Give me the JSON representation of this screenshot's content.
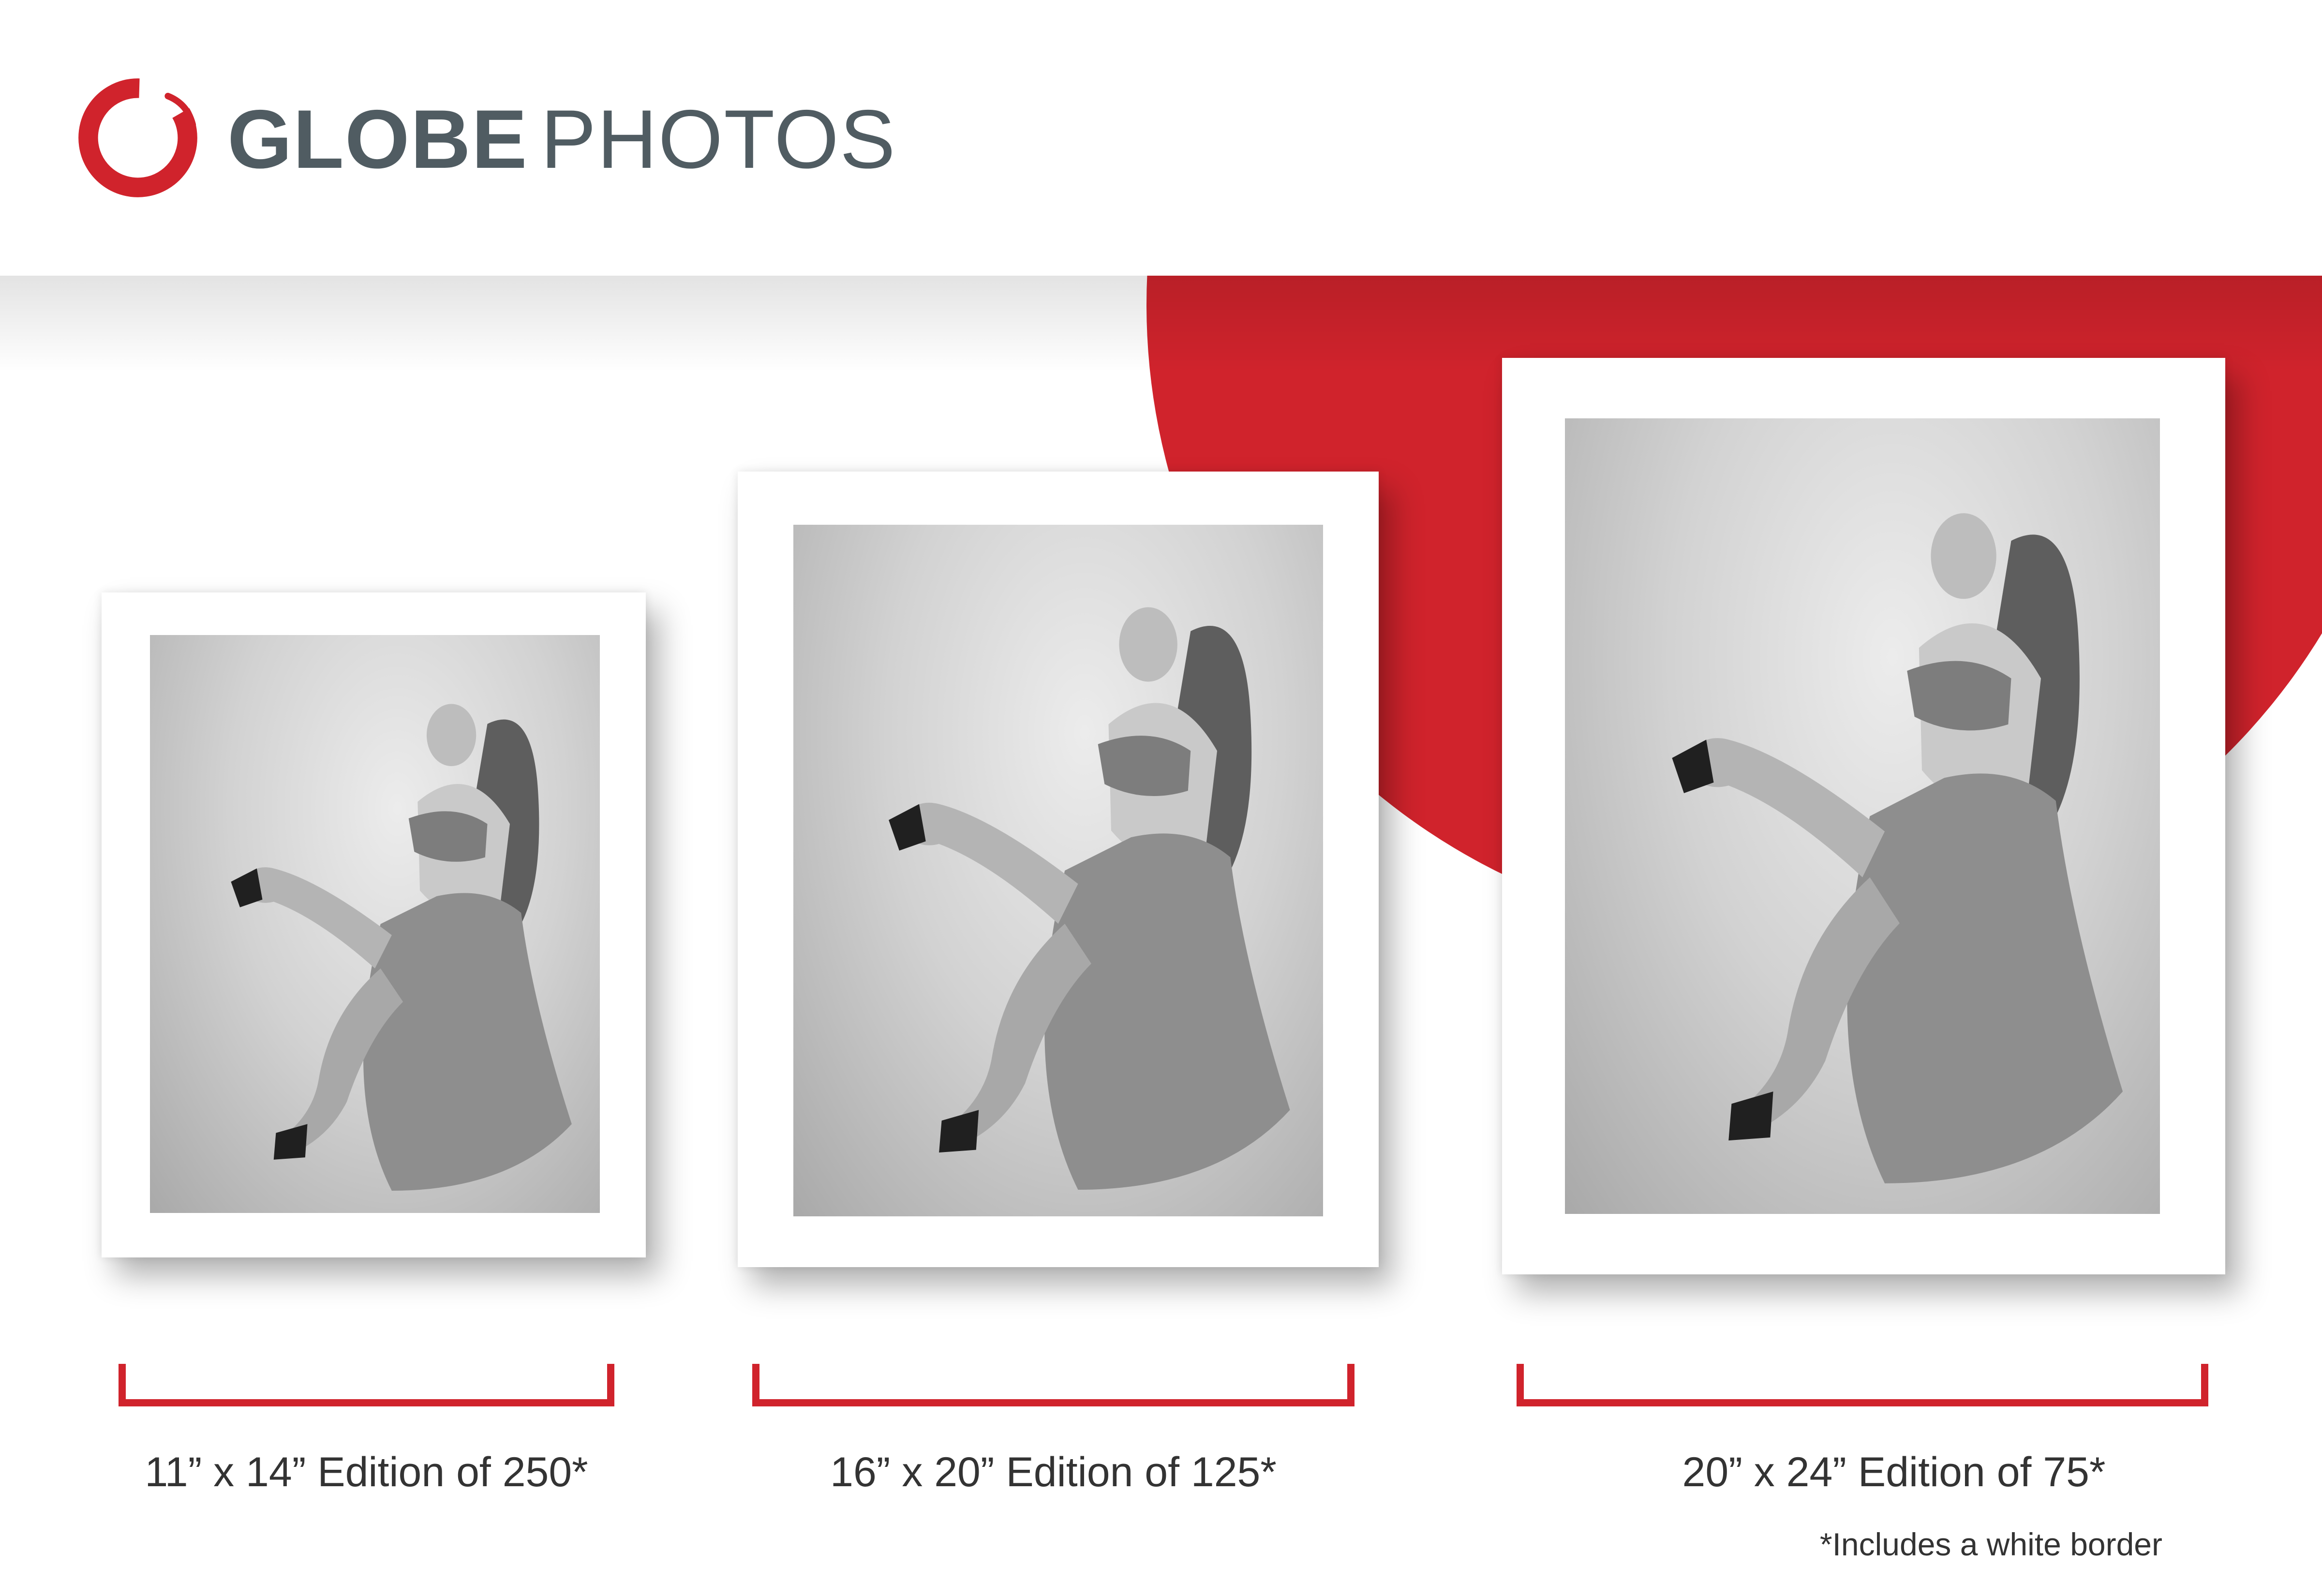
{
  "brand": {
    "name_bold": "GLOBE",
    "name_light": "PHOTOS",
    "logo_icon": "red-brush-ring-icon",
    "accent_color": "#d0232c",
    "text_color": "#505c62"
  },
  "prints": [
    {
      "size": "11” x 14”",
      "edition": "Edition of 250*"
    },
    {
      "size": "16” x 20”",
      "edition": "Edition of 125*"
    },
    {
      "size": "20” x 24”",
      "edition": "Edition of 75*"
    }
  ],
  "footnote": "*Includes a white border"
}
